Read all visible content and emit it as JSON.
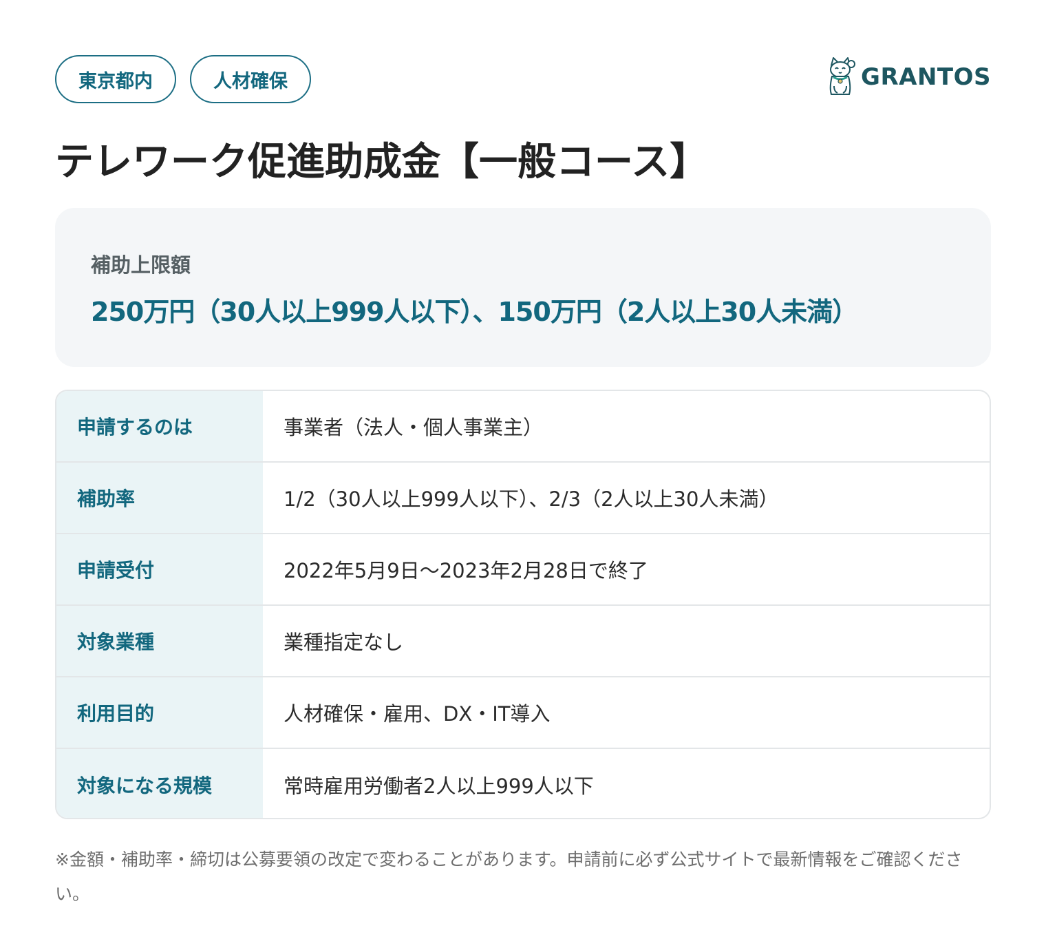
{
  "tags": [
    "東京都内",
    "人材確保"
  ],
  "logo": {
    "text": "GRANTOS",
    "mark_icon": "maneki-neko-cat-icon"
  },
  "title": "テレワーク促進助成金【一般コース】",
  "limit": {
    "label": "補助上限額",
    "value": "250万円（30人以上999人以下）、150万円（2人以上30人未満）"
  },
  "details": [
    {
      "key": "申請するのは",
      "value": "事業者（法人・個人事業主）"
    },
    {
      "key": "補助率",
      "value": "1/2（30人以上999人以下）、2/3（2人以上30人未満）"
    },
    {
      "key": "申請受付",
      "value": "2022年5月9日〜2023年2月28日で終了"
    },
    {
      "key": "対象業種",
      "value": "業種指定なし"
    },
    {
      "key": "利用目的",
      "value": "人材確保・雇用、DX・IT導入"
    },
    {
      "key": "対象になる規模",
      "value": "常時雇用労働者2人以上999人以下"
    }
  ],
  "note": "※金額・補助率・締切は公募要領の改定で変わることがあります。申請前に必ず公式サイトで最新情報をご確認ください。",
  "colors": {
    "accent": "#12677e",
    "key_bg": "#eaf4f6",
    "box_bg": "#f4f6f8",
    "logo": "#1d5660"
  }
}
